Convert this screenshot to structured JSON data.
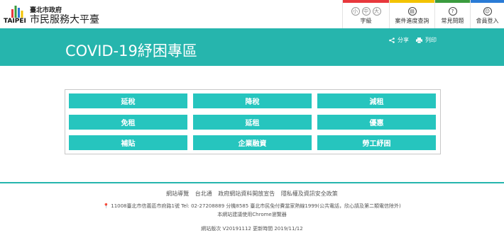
{
  "header": {
    "logo_text": "TAIPEI",
    "org_small": "臺北市政府",
    "org_big": "市民服務大平臺",
    "font_size": {
      "label": "字級",
      "options": [
        "小",
        "中",
        "大"
      ]
    },
    "nav": [
      {
        "label": "案件進度查詢",
        "icon": "document-icon",
        "bar_color": "#f3c300"
      },
      {
        "label": "常見問題",
        "icon": "question-icon",
        "bar_color": "#3a9b3e"
      },
      {
        "label": "會員登入",
        "icon": "user-icon",
        "bar_color": "#2a7bd6"
      }
    ],
    "font_bar_color": "#e8383d"
  },
  "banner": {
    "title": "COVID-19紓困專區",
    "share_label": "分享",
    "print_label": "列印"
  },
  "relief_buttons": [
    "延稅",
    "降稅",
    "減租",
    "免租",
    "延租",
    "優惠",
    "補貼",
    "企業融資",
    "勞工紓困"
  ],
  "footer": {
    "links": [
      "網站導覽",
      "台北通",
      "政府網站資料開放宣告",
      "隱私權及資訊安全政策"
    ],
    "address": "11008臺北市信義區市府路1號 Tel: 02-27208889 分機8585 臺北市民免付費當家熱線1999(公共電話，欣心請及第二類電信除外)",
    "browser_note": "本網站建議使用Chrome瀏覽器",
    "version": "網站版次 V20191112 更新時間 2019/11/12"
  },
  "colors": {
    "accent": "#26b5ad",
    "button": "#26c5be"
  }
}
